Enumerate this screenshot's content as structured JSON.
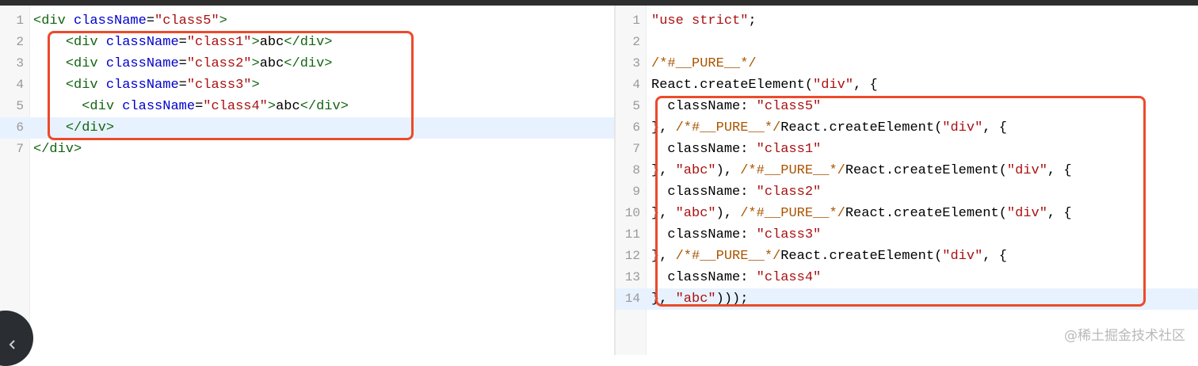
{
  "left_editor": {
    "lines": [
      {
        "n": "1",
        "segs": [
          {
            "t": "tag",
            "v": "<div "
          },
          {
            "t": "attr",
            "v": "className"
          },
          {
            "t": "kw",
            "v": "="
          },
          {
            "t": "str",
            "v": "\"class5\""
          },
          {
            "t": "tag",
            "v": ">"
          }
        ]
      },
      {
        "n": "2",
        "segs": [
          {
            "t": "kw",
            "v": "    "
          },
          {
            "t": "tag",
            "v": "<div "
          },
          {
            "t": "attr",
            "v": "className"
          },
          {
            "t": "kw",
            "v": "="
          },
          {
            "t": "str",
            "v": "\"class1\""
          },
          {
            "t": "tag",
            "v": ">"
          },
          {
            "t": "kw",
            "v": "abc"
          },
          {
            "t": "tag",
            "v": "</div>"
          }
        ]
      },
      {
        "n": "3",
        "segs": [
          {
            "t": "kw",
            "v": "    "
          },
          {
            "t": "tag",
            "v": "<div "
          },
          {
            "t": "attr",
            "v": "className"
          },
          {
            "t": "kw",
            "v": "="
          },
          {
            "t": "str",
            "v": "\"class2\""
          },
          {
            "t": "tag",
            "v": ">"
          },
          {
            "t": "kw",
            "v": "abc"
          },
          {
            "t": "tag",
            "v": "</div>"
          }
        ]
      },
      {
        "n": "4",
        "segs": [
          {
            "t": "kw",
            "v": "    "
          },
          {
            "t": "tag",
            "v": "<div "
          },
          {
            "t": "attr",
            "v": "className"
          },
          {
            "t": "kw",
            "v": "="
          },
          {
            "t": "str",
            "v": "\"class3\""
          },
          {
            "t": "tag",
            "v": ">"
          }
        ]
      },
      {
        "n": "5",
        "segs": [
          {
            "t": "kw",
            "v": "      "
          },
          {
            "t": "tag",
            "v": "<div "
          },
          {
            "t": "attr",
            "v": "className"
          },
          {
            "t": "kw",
            "v": "="
          },
          {
            "t": "str",
            "v": "\"class4\""
          },
          {
            "t": "tag",
            "v": ">"
          },
          {
            "t": "kw",
            "v": "abc"
          },
          {
            "t": "tag",
            "v": "</div>"
          }
        ]
      },
      {
        "n": "6",
        "active": true,
        "segs": [
          {
            "t": "kw",
            "v": "    "
          },
          {
            "t": "tag",
            "v": "</div>"
          }
        ]
      },
      {
        "n": "7",
        "segs": [
          {
            "t": "tag",
            "v": "</div>"
          }
        ]
      }
    ]
  },
  "right_editor": {
    "lines": [
      {
        "n": "1",
        "segs": [
          {
            "t": "str",
            "v": "\"use strict\""
          },
          {
            "t": "kw",
            "v": ";"
          }
        ]
      },
      {
        "n": "2",
        "segs": []
      },
      {
        "n": "3",
        "segs": [
          {
            "t": "cmt",
            "v": "/*#__PURE__*/"
          }
        ]
      },
      {
        "n": "4",
        "segs": [
          {
            "t": "kw",
            "v": "React.createElement("
          },
          {
            "t": "str",
            "v": "\"div\""
          },
          {
            "t": "kw",
            "v": ", {"
          }
        ]
      },
      {
        "n": "5",
        "segs": [
          {
            "t": "kw",
            "v": "  className: "
          },
          {
            "t": "str",
            "v": "\"class5\""
          }
        ]
      },
      {
        "n": "6",
        "segs": [
          {
            "t": "kw",
            "v": "}, "
          },
          {
            "t": "cmt",
            "v": "/*#__PURE__*/"
          },
          {
            "t": "kw",
            "v": "React.createElement("
          },
          {
            "t": "str",
            "v": "\"div\""
          },
          {
            "t": "kw",
            "v": ", {"
          }
        ]
      },
      {
        "n": "7",
        "segs": [
          {
            "t": "kw",
            "v": "  className: "
          },
          {
            "t": "str",
            "v": "\"class1\""
          }
        ]
      },
      {
        "n": "8",
        "segs": [
          {
            "t": "kw",
            "v": "}, "
          },
          {
            "t": "str",
            "v": "\"abc\""
          },
          {
            "t": "kw",
            "v": "), "
          },
          {
            "t": "cmt",
            "v": "/*#__PURE__*/"
          },
          {
            "t": "kw",
            "v": "React.createElement("
          },
          {
            "t": "str",
            "v": "\"div\""
          },
          {
            "t": "kw",
            "v": ", {"
          }
        ]
      },
      {
        "n": "9",
        "segs": [
          {
            "t": "kw",
            "v": "  className: "
          },
          {
            "t": "str",
            "v": "\"class2\""
          }
        ]
      },
      {
        "n": "10",
        "segs": [
          {
            "t": "kw",
            "v": "}, "
          },
          {
            "t": "str",
            "v": "\"abc\""
          },
          {
            "t": "kw",
            "v": "), "
          },
          {
            "t": "cmt",
            "v": "/*#__PURE__*/"
          },
          {
            "t": "kw",
            "v": "React.createElement("
          },
          {
            "t": "str",
            "v": "\"div\""
          },
          {
            "t": "kw",
            "v": ", {"
          }
        ]
      },
      {
        "n": "11",
        "segs": [
          {
            "t": "kw",
            "v": "  className: "
          },
          {
            "t": "str",
            "v": "\"class3\""
          }
        ]
      },
      {
        "n": "12",
        "segs": [
          {
            "t": "kw",
            "v": "}, "
          },
          {
            "t": "cmt",
            "v": "/*#__PURE__*/"
          },
          {
            "t": "kw",
            "v": "React.createElement("
          },
          {
            "t": "str",
            "v": "\"div\""
          },
          {
            "t": "kw",
            "v": ", {"
          }
        ]
      },
      {
        "n": "13",
        "segs": [
          {
            "t": "kw",
            "v": "  className: "
          },
          {
            "t": "str",
            "v": "\"class4\""
          }
        ]
      },
      {
        "n": "14",
        "active": true,
        "segs": [
          {
            "t": "kw",
            "v": "}, "
          },
          {
            "t": "str",
            "v": "\"abc\""
          },
          {
            "t": "kw",
            "v": ")));"
          }
        ]
      }
    ]
  },
  "syntax_colors": {
    "tag": "#116611",
    "attr": "#0000cc",
    "string": "#aa1111",
    "comment": "#aa5500",
    "highlight_box": "#ec4a2c",
    "active_line": "#e8f2ff"
  },
  "fab": {
    "icon": "chevron-left-icon"
  },
  "watermark": "@稀土掘金技术社区"
}
